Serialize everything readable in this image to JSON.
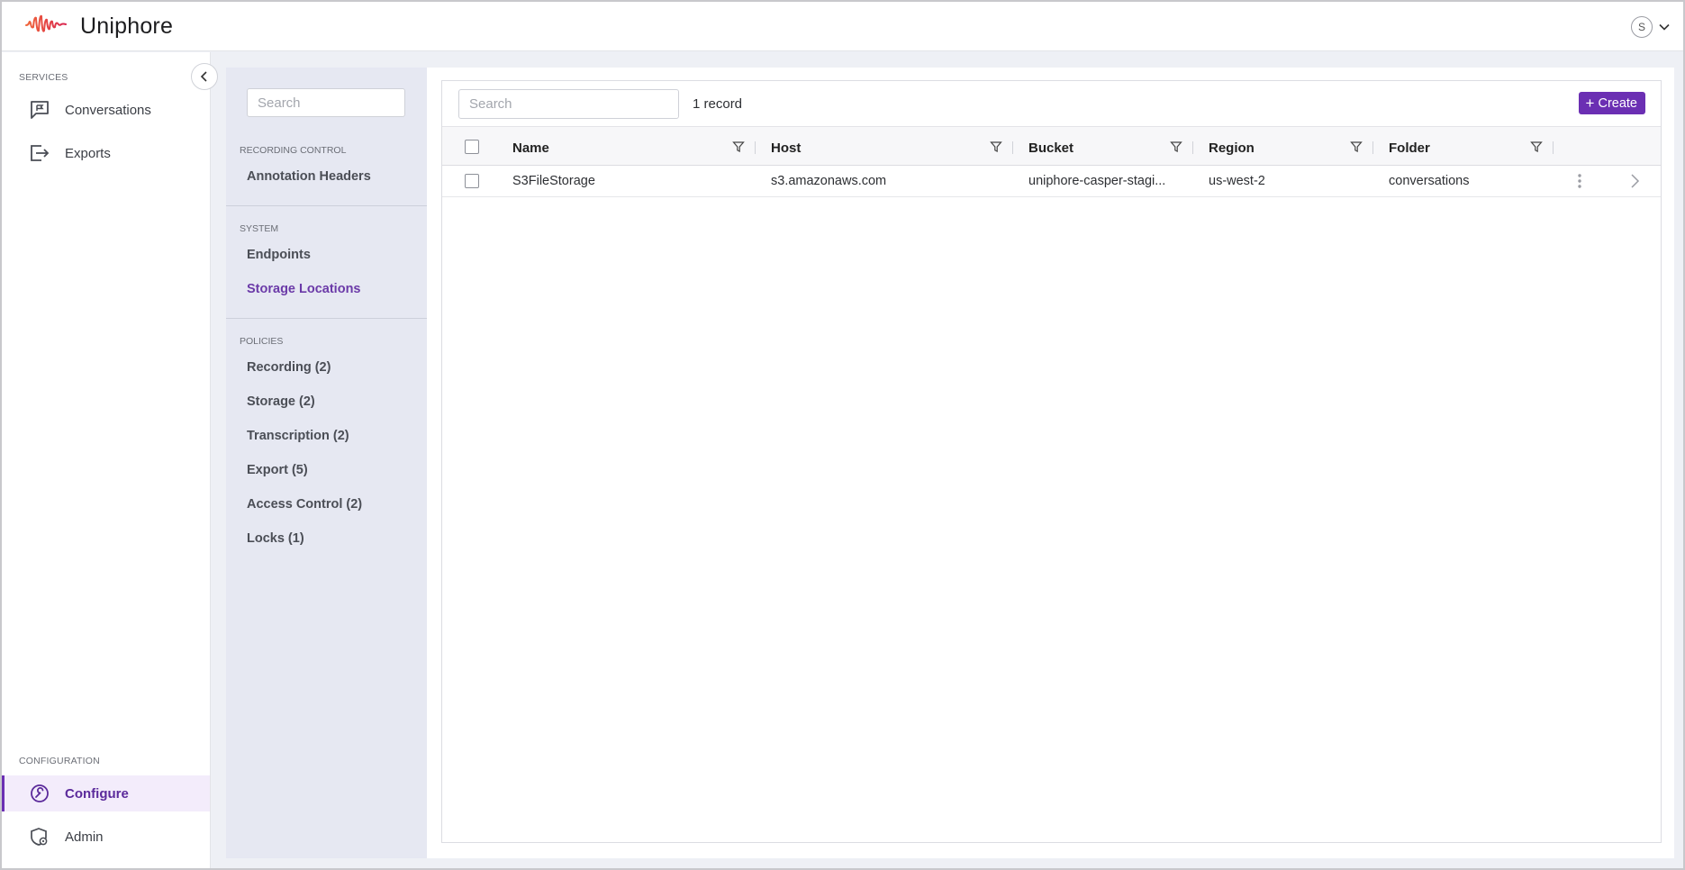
{
  "app": {
    "brand": "Uniphore",
    "user_initial": "S"
  },
  "colors": {
    "accent": "#6b2fb3",
    "logo_orange": "#f0663a",
    "logo_red": "#d9264f",
    "subnav_bg": "#e6e8f2"
  },
  "sidebar": {
    "services_label": "SERVICES",
    "items": [
      {
        "label": "Conversations",
        "icon": "chat-flag-icon"
      },
      {
        "label": "Exports",
        "icon": "export-icon"
      }
    ],
    "configuration_label": "CONFIGURATION",
    "config_items": [
      {
        "label": "Configure",
        "icon": "wrench-icon",
        "active": true
      },
      {
        "label": "Admin",
        "icon": "shield-gear-icon"
      }
    ]
  },
  "subnav": {
    "search_placeholder": "Search",
    "recording_control_label": "RECORDING CONTROL",
    "annotation_headers": "Annotation Headers",
    "system_label": "SYSTEM",
    "endpoints": "Endpoints",
    "storage_locations": "Storage Locations",
    "policies_label": "POLICIES",
    "policies": [
      "Recording (2)",
      "Storage (2)",
      "Transcription (2)",
      "Export (5)",
      "Access Control (2)",
      "Locks (1)"
    ]
  },
  "grid": {
    "search_placeholder": "Search",
    "record_count": "1 record",
    "create_label": "Create",
    "columns": [
      "Name",
      "Host",
      "Bucket",
      "Region",
      "Folder"
    ],
    "rows": [
      {
        "name": "S3FileStorage",
        "host": "s3.amazonaws.com",
        "bucket": "uniphore-casper-stagi...",
        "region": "us-west-2",
        "folder": "conversations"
      }
    ]
  }
}
